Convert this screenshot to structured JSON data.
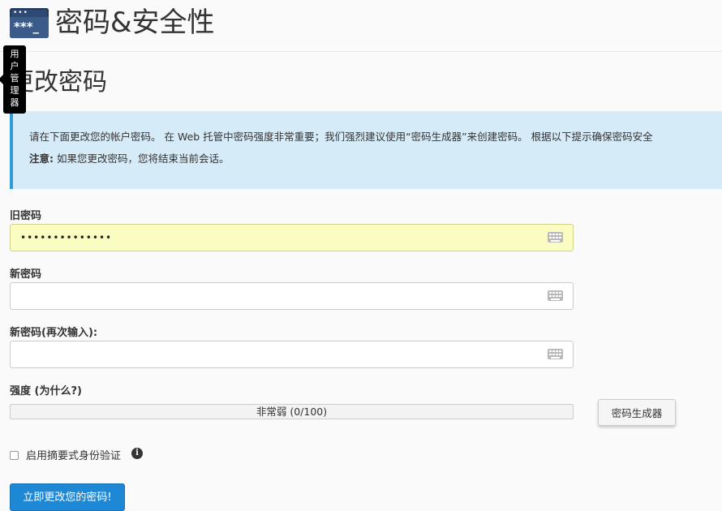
{
  "header": {
    "icon": "password-terminal-icon",
    "icon_dots": "•••",
    "icon_text": "***_",
    "title": "密码&安全性"
  },
  "tooltip": {
    "chars": [
      "用",
      "户",
      "管",
      "理",
      "器"
    ]
  },
  "section": {
    "title": "更改密码"
  },
  "info": {
    "line1": "请在下面更改您的帐户密码。 在 Web 托管中密码强度非常重要；我们强烈建议使用“密码生成器”来创建密码。 根据以下提示确保密码安全",
    "note_label": "注意:",
    "note_text": " 如果您更改密码，您将结束当前会话。"
  },
  "form": {
    "old_password": {
      "label": "旧密码",
      "value": "••••••••••••••"
    },
    "new_password": {
      "label": "新密码",
      "value": ""
    },
    "confirm_password": {
      "label": "新密码(再次输入):",
      "value": ""
    },
    "strength": {
      "label": "强度 (为什么?)",
      "text": "非常弱 (0/100)",
      "score": 0,
      "max": 100
    },
    "generator_button": "密码生成器",
    "digest_auth": {
      "label": "启用摘要式身份验证",
      "checked": false
    },
    "submit_button": "立即更改您的密码!"
  },
  "colors": {
    "accent": "#1f88d5",
    "info_background": "#d6ebf8",
    "autofill": "#fafcc2"
  }
}
